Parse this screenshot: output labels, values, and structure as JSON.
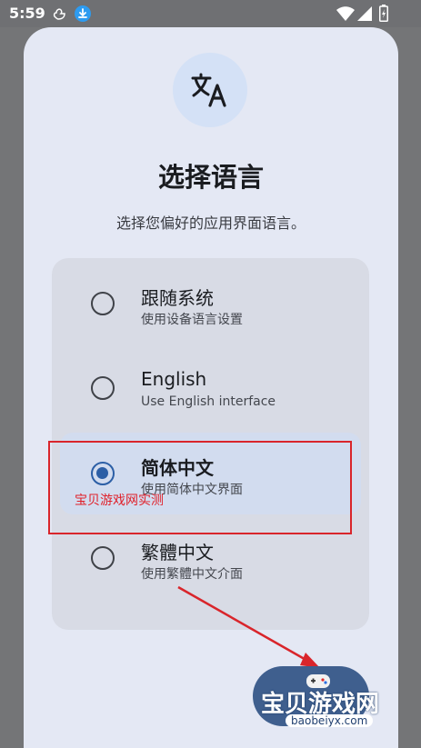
{
  "status_bar": {
    "time": "5:59",
    "icons": [
      "duck-icon",
      "download-icon",
      "wifi-icon",
      "signal-icon",
      "battery-icon"
    ]
  },
  "dialog": {
    "icon": "translate-icon",
    "title": "选择语言",
    "subtitle": "选择您偏好的应用界面语言。"
  },
  "options": [
    {
      "title": "跟随系统",
      "description": "使用设备语言设置",
      "selected": false
    },
    {
      "title": "English",
      "description": "Use English interface",
      "selected": false
    },
    {
      "title": "简体中文",
      "description": "使用简体中文界面",
      "selected": true
    },
    {
      "title": "繁體中文",
      "description": "使用繁體中文介面",
      "selected": false
    }
  ],
  "overlay": {
    "caption": "宝贝游戏网实测",
    "watermark_title": "宝贝游戏网",
    "watermark_url": "baobeiyx.com"
  },
  "colors": {
    "accent": "#2c5fa6",
    "dialog_background": "#e4e8f4",
    "annotation_red": "#d9252b"
  }
}
